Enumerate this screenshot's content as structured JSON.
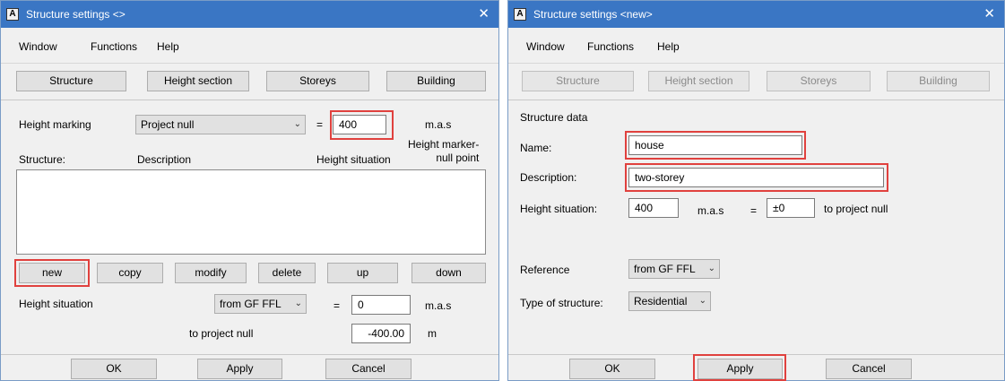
{
  "left": {
    "title": "Structure settings <>",
    "menu": [
      "Window",
      "Functions",
      "Help"
    ],
    "tabs": [
      "Structure",
      "Height section",
      "Storeys",
      "Building"
    ],
    "height_marking_label": "Height marking",
    "height_marking_value": "Project null",
    "eq1": "=",
    "height_marking_input": "400",
    "height_marking_unit": "m.a.s",
    "col_structure": "Structure:",
    "col_description": "Description",
    "col_height_situation": "Height situation",
    "col_height_marker": "Height marker-\nnull point",
    "buttons": [
      "new",
      "copy",
      "modify",
      "delete",
      "up",
      "down"
    ],
    "height_situation_label": "Height situation",
    "height_situation_combo": "from GF FFL",
    "eq2": "=",
    "height_situation_input": "0",
    "height_situation_unit": "m.a.s",
    "to_project_null_label": "to project null",
    "to_project_null_value": "-400.00",
    "to_project_null_unit": "m",
    "ok": "OK",
    "apply": "Apply",
    "cancel": "Cancel"
  },
  "right": {
    "title": "Structure settings <new>",
    "menu": [
      "Window",
      "Functions",
      "Help"
    ],
    "tabs": [
      "Structure",
      "Height section",
      "Storeys",
      "Building"
    ],
    "section_title": "Structure data",
    "name_label": "Name:",
    "name_value": "house",
    "description_label": "Description:",
    "description_value": "two-storey",
    "height_situation_label": "Height situation:",
    "height_situation_value": "400",
    "height_situation_unit": "m.a.s",
    "eq": "=",
    "offset_value": "±0",
    "to_project_null": "to project null",
    "reference_label": "Reference",
    "reference_value": "from GF FFL",
    "type_label": "Type of structure:",
    "type_value": "Residential",
    "ok": "OK",
    "apply": "Apply",
    "cancel": "Cancel"
  },
  "icons": {
    "app": "app-icon",
    "close": "close-icon",
    "dropdown": "chevron-down-icon"
  },
  "colors": {
    "titlebar": "#3a76c4",
    "highlight": "#e0413e",
    "disabled_text": "#8a8a8a"
  }
}
